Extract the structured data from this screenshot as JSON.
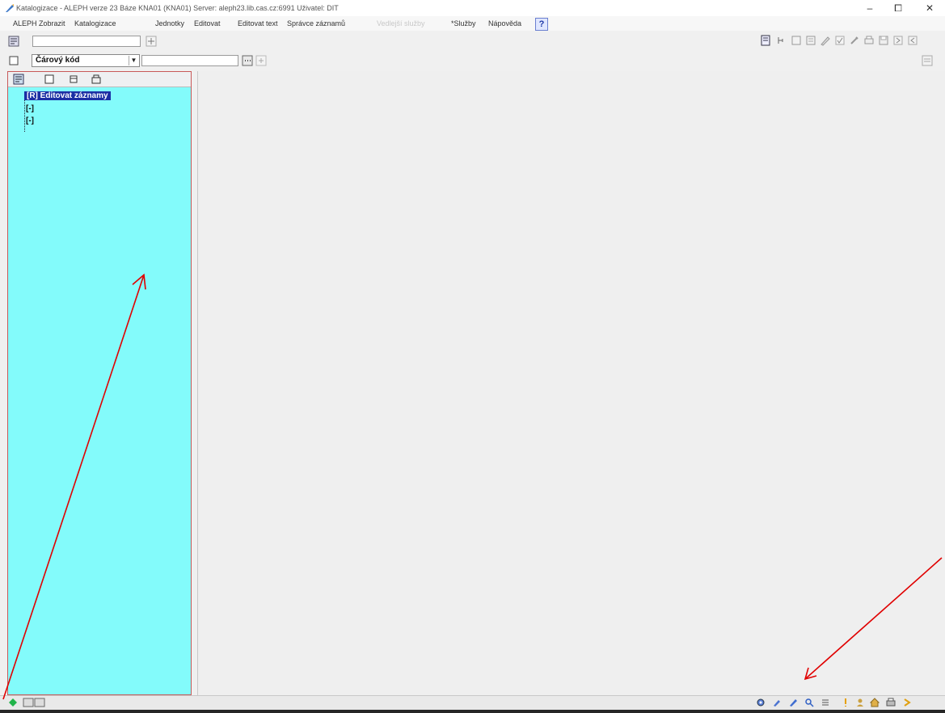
{
  "window": {
    "title": "Katalogizace - ALEPH verze 23  Báze KNA01 (KNA01)  Server: aleph23.lib.cas.cz:6991  Uživatel: DIT",
    "minimize": "–",
    "maximize": "⧠",
    "close": "✕"
  },
  "menu": {
    "items": [
      "ALEPH",
      "Zobrazit",
      "Katalogizace",
      "Jednotky",
      "Editovat",
      "Editovat text",
      "Správce záznamů",
      "Vedlejší služby",
      "*Služby",
      "Nápověda"
    ],
    "help_label": "?"
  },
  "search": {
    "type_selected": "Čárový kód",
    "value": "",
    "plus_label": "+"
  },
  "tree": {
    "root_label": "[R] Editovat záznamy",
    "child_1": "[-]",
    "child_2": "[-]"
  },
  "colors": {
    "tree_bg": "#83fbfb",
    "selection": "#1b2fa4",
    "annotation_arrow": "#e00000"
  }
}
